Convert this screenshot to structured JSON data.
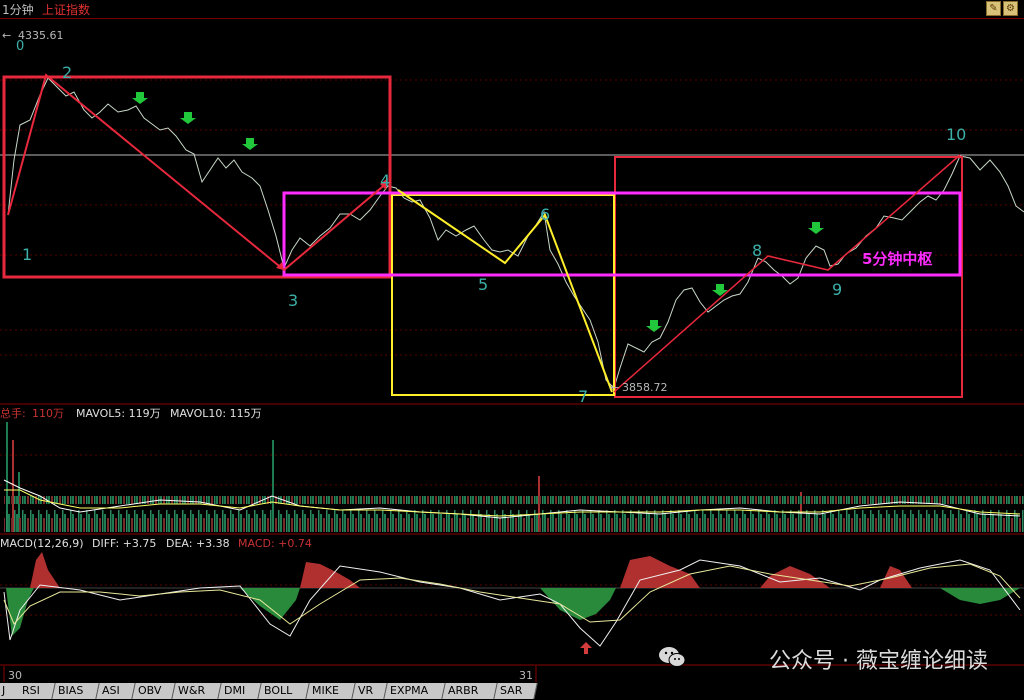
{
  "header": {
    "period": "1分钟",
    "index_name": "上证指数"
  },
  "price_panel": {
    "high_marker": "4335.61",
    "low_marker": "3858.72",
    "top_label": "0",
    "center_label": "5分钟中枢",
    "wave_labels": [
      "1",
      "2",
      "3",
      "4",
      "5",
      "6",
      "7",
      "8",
      "9",
      "10"
    ]
  },
  "volume_panel": {
    "label_prefix": "总手:",
    "total": "110万",
    "mavol5": "MAVOL5: 119万",
    "mavol10": "MAVOL10: 115万"
  },
  "macd_panel": {
    "name": "MACD(12,26,9)",
    "diff": "DIFF: +3.75",
    "dea": "DEA: +3.38",
    "macd": "MACD: +0.74"
  },
  "date_labels": [
    "30",
    "31"
  ],
  "tabs": [
    "RSI",
    "BIAS",
    "ASI",
    "OBV",
    "W&R",
    "DMI",
    "BOLL",
    "MIKE",
    "VR",
    "EXPMA",
    "ARBR",
    "SAR"
  ],
  "watermark": "公众号 · 薇宝缠论细读",
  "colors": {
    "red_box": "#e8283c",
    "yellow_box": "#ffef2a",
    "magenta_box": "#ff2bff",
    "green_arrow": "#22c83c",
    "up_arrow": "#d23c3c"
  }
}
